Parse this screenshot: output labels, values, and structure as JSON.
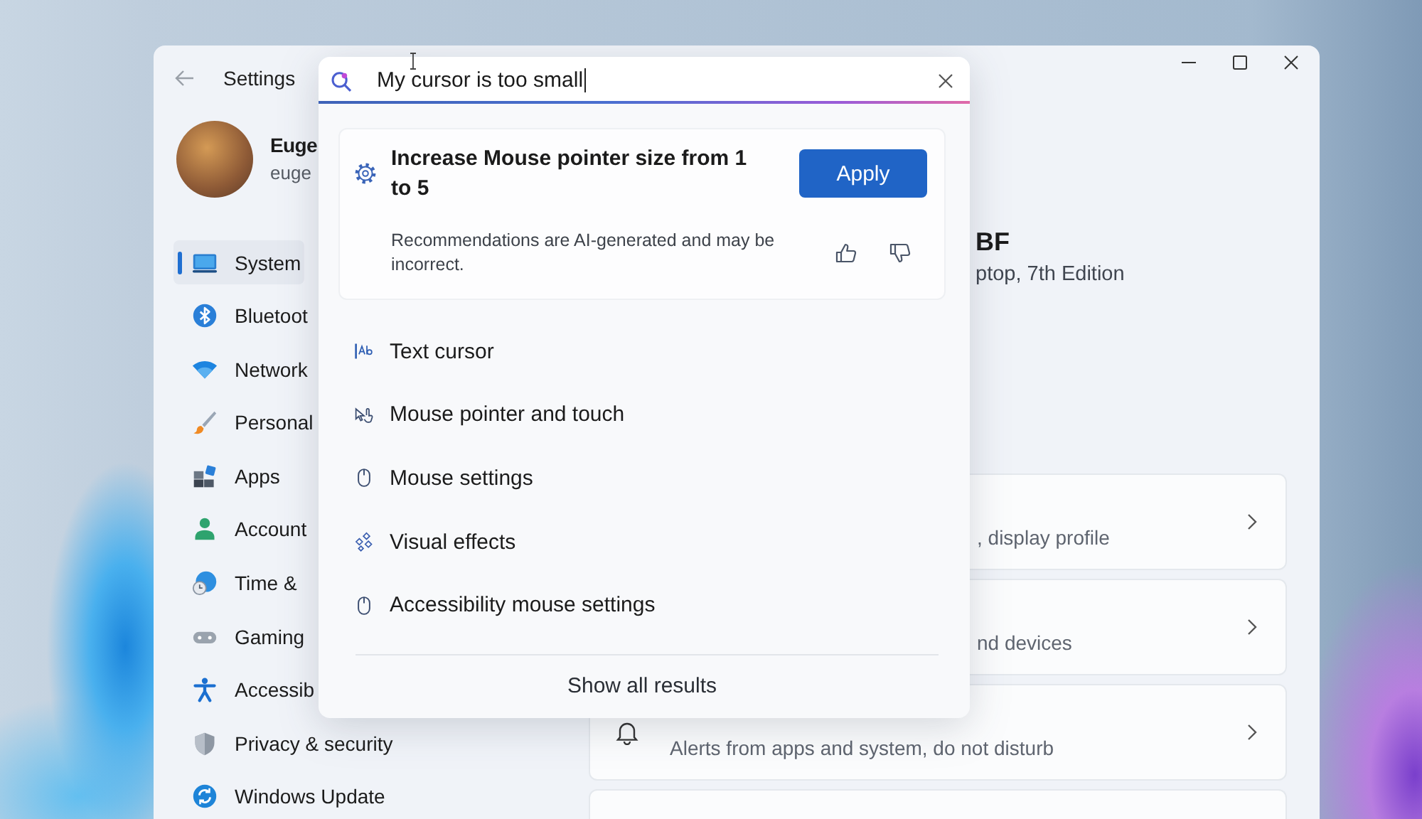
{
  "window": {
    "title": "Settings"
  },
  "search": {
    "value": "My cursor is too small"
  },
  "profile": {
    "name": "Euge",
    "email": "euge"
  },
  "sidebar": {
    "items": [
      {
        "label": "System",
        "selected": true
      },
      {
        "label": "Bluetoot",
        "selected": false
      },
      {
        "label": "Network",
        "selected": false
      },
      {
        "label": "Personal",
        "selected": false
      },
      {
        "label": "Apps",
        "selected": false
      },
      {
        "label": "Account",
        "selected": false
      },
      {
        "label": "Time &",
        "selected": false
      },
      {
        "label": "Gaming",
        "selected": false
      },
      {
        "label": "Accessib",
        "selected": false
      },
      {
        "label": "Privacy & security",
        "selected": false
      },
      {
        "label": "Windows Update",
        "selected": false
      }
    ]
  },
  "device": {
    "name": "BF",
    "model": "ptop, 7th Edition"
  },
  "cards": [
    {
      "description": ", display profile"
    },
    {
      "description": "nd devices"
    },
    {
      "description": "Alerts from apps and system, do not disturb"
    }
  ],
  "suggestion": {
    "title": "Increase Mouse pointer size from 1 to 5",
    "button": "Apply",
    "disclaimer": "Recommendations are AI-generated and may be incorrect."
  },
  "results": [
    {
      "label": "Text cursor"
    },
    {
      "label": "Mouse pointer and touch"
    },
    {
      "label": "Mouse settings"
    },
    {
      "label": "Visual effects"
    },
    {
      "label": "Accessibility mouse settings"
    }
  ],
  "show_all": "Show all results"
}
